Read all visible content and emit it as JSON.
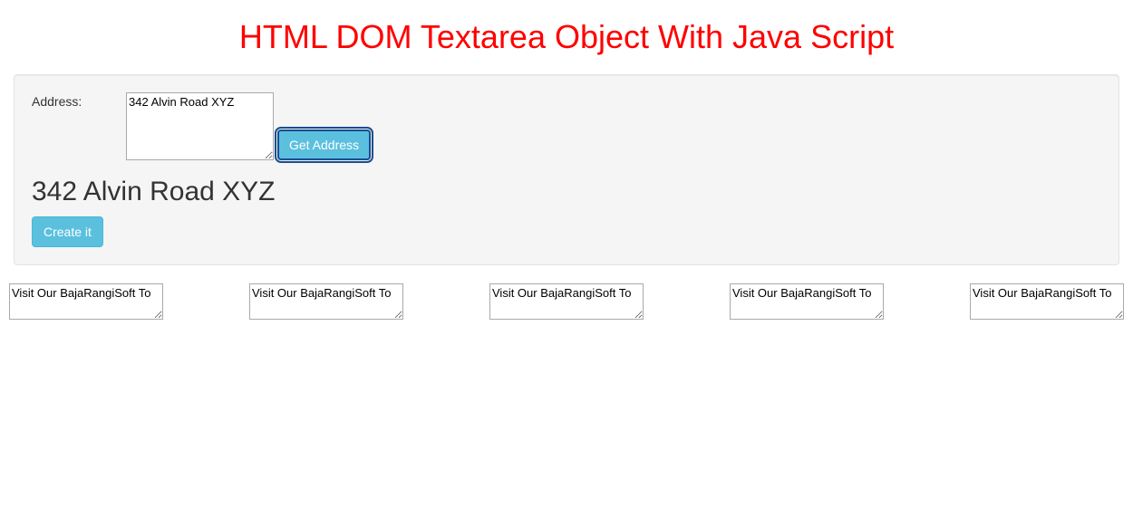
{
  "title": "HTML DOM Textarea Object With Java Script",
  "form": {
    "address_label": "Address:",
    "address_value": "342 Alvin Road XYZ",
    "get_address_button": "Get Address"
  },
  "result": "342 Alvin Road XYZ",
  "create_button": "Create it",
  "small_textareas": [
    "Visit Our BajaRangiSoft To",
    "Visit Our BajaRangiSoft To",
    "Visit Our BajaRangiSoft To",
    "Visit Our BajaRangiSoft To",
    "Visit Our BajaRangiSoft To"
  ]
}
